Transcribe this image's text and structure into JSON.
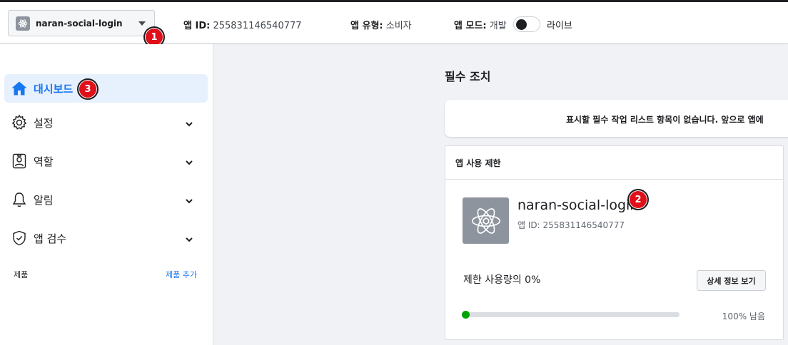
{
  "header": {
    "app_name": "naran-social-login",
    "app_id_label": "앱 ID:",
    "app_id_value": "255831146540777",
    "app_type_label": "앱 유형:",
    "app_type_value": "소비자",
    "app_mode_label": "앱 모드:",
    "app_mode_dev": "개발",
    "app_mode_live": "라이브",
    "live_mode_on": false
  },
  "badges": {
    "one": "1",
    "two": "2",
    "three": "3"
  },
  "sidebar": {
    "items": [
      {
        "label": "대시보드",
        "icon": "home-icon",
        "active": true
      },
      {
        "label": "설정",
        "icon": "gear-icon"
      },
      {
        "label": "역할",
        "icon": "user-badge-icon"
      },
      {
        "label": "알림",
        "icon": "bell-icon"
      },
      {
        "label": "앱 검수",
        "icon": "shield-check-icon"
      }
    ],
    "products_label": "제품",
    "products_add": "제품 추가"
  },
  "main": {
    "section_title": "필수 조치",
    "notice": "표시할 필수 작업 리스트 항목이 없습니다. 앞으로 앱에",
    "panel": {
      "title": "앱 사용 제한",
      "app_name": "naran-social-login",
      "app_id": "앱 ID: 255831146540777",
      "usage_text": "제한 사용량의 0%",
      "detail_button": "상세 정보 보기",
      "usage_percent": 0,
      "remaining_text": "100% 남음"
    }
  },
  "colors": {
    "accent": "#1877f2",
    "badge": "#e0101b",
    "progress": "#00a400"
  }
}
